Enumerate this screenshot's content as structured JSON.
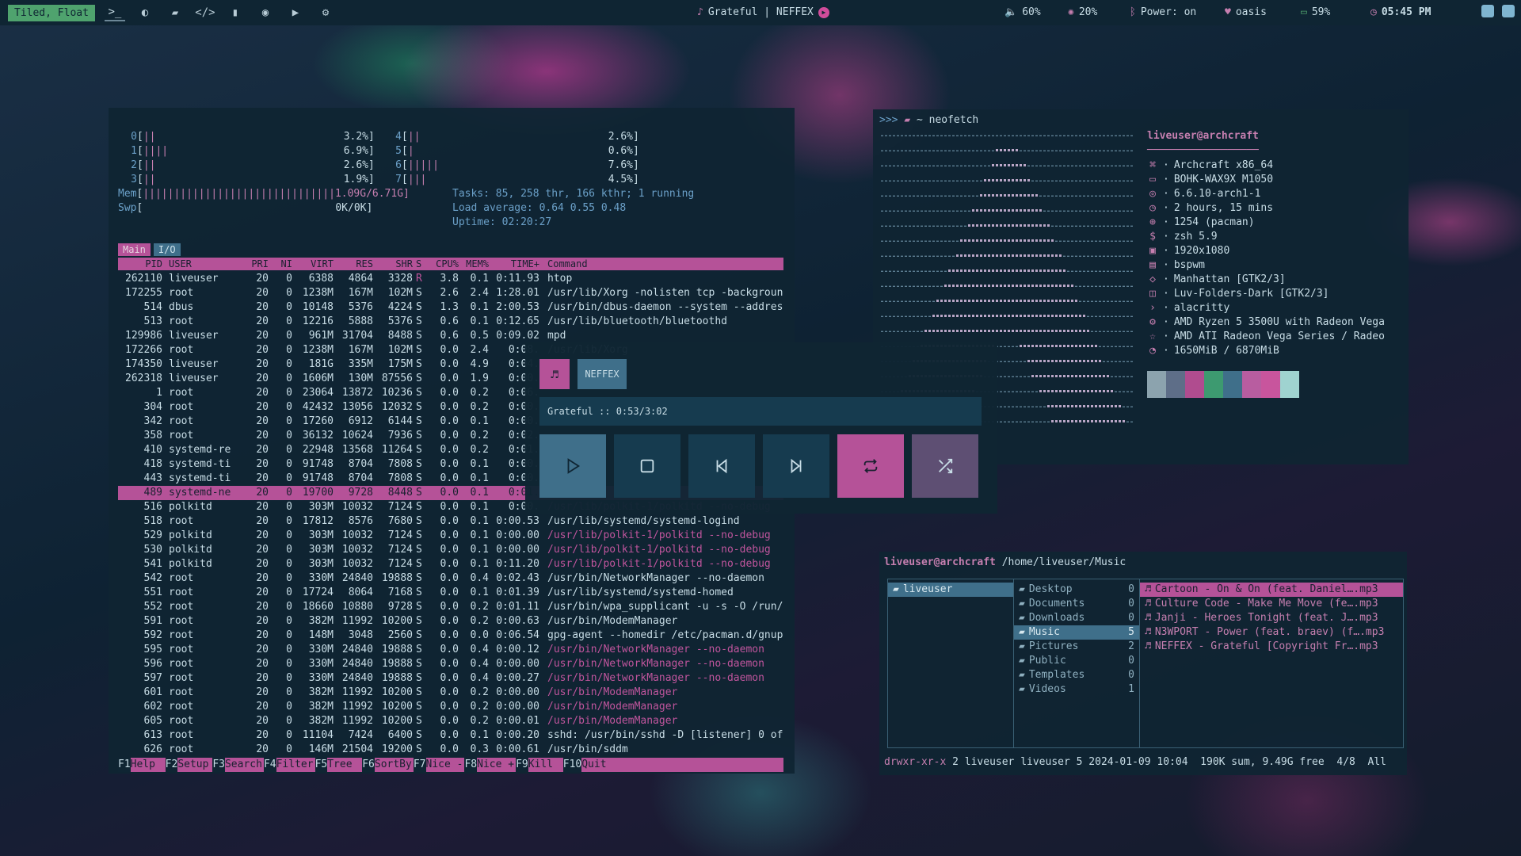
{
  "topbar": {
    "layout": "Tiled, Float",
    "now_playing": "Grateful | NEFFEX",
    "volume": "60%",
    "brightness": "20%",
    "bluetooth": "Power: on",
    "network": "oasis",
    "battery": "59%",
    "clock": "05:45 PM"
  },
  "htop": {
    "cpus": [
      {
        "id": "0",
        "bars": "||",
        "pct": "3.2%]"
      },
      {
        "id": "1",
        "bars": "||||",
        "pct": "6.9%]"
      },
      {
        "id": "2",
        "bars": "||",
        "pct": "2.6%]"
      },
      {
        "id": "3",
        "bars": "||",
        "pct": "1.9%]"
      },
      {
        "id": "4",
        "bars": "||",
        "pct": "2.6%]"
      },
      {
        "id": "5",
        "bars": "|",
        "pct": "0.6%]"
      },
      {
        "id": "6",
        "bars": "|||||",
        "pct": "7.6%]"
      },
      {
        "id": "7",
        "bars": "|||",
        "pct": "4.5%]"
      }
    ],
    "mem_label": "Mem",
    "mem_bars": "|||||||||||||||||||||||||||||||1.09G/6.71G]",
    "swp_label": "Swp",
    "swp_value": "0K/0K]",
    "tasks": "Tasks: 85, 258 thr, 166 kthr; 1 running",
    "load": "Load average: 0.64 0.55 0.48",
    "uptime": "Uptime: 02:20:27",
    "tabs": [
      "Main",
      "I/O"
    ],
    "headers": [
      "PID",
      "USER",
      "PRI",
      "NI",
      "VIRT",
      "RES",
      "SHR",
      "S",
      "CPU%",
      "MEM%",
      "TIME+",
      "Command"
    ],
    "rows": [
      [
        "262110",
        "liveuser",
        "20",
        "0",
        "6388",
        "4864",
        "3328",
        "R",
        "3.8",
        "0.1",
        "0:11.93",
        "htop"
      ],
      [
        "172255",
        "root",
        "20",
        "0",
        "1238M",
        "167M",
        "102M",
        "S",
        "2.6",
        "2.4",
        "1:28.01",
        "/usr/lib/Xorg -nolisten tcp -backgroun"
      ],
      [
        "514",
        "dbus",
        "20",
        "0",
        "10148",
        "5376",
        "4224",
        "S",
        "1.3",
        "0.1",
        "2:00.53",
        "/usr/bin/dbus-daemon --system --addres"
      ],
      [
        "513",
        "root",
        "20",
        "0",
        "12216",
        "5888",
        "5376",
        "S",
        "0.6",
        "0.1",
        "0:12.65",
        "/usr/lib/bluetooth/bluetoothd"
      ],
      [
        "129986",
        "liveuser",
        "20",
        "0",
        "961M",
        "31704",
        "8488",
        "S",
        "0.6",
        "0.5",
        "0:09.02",
        "mpd"
      ],
      [
        "172266",
        "root",
        "20",
        "0",
        "1238M",
        "167M",
        "102M",
        "S",
        "0.0",
        "2.4",
        "0:08.",
        "/usr/lib/Xorg"
      ],
      [
        "174350",
        "liveuser",
        "20",
        "0",
        "181G",
        "335M",
        "175M",
        "S",
        "0.0",
        "4.9",
        "0:04.",
        ""
      ],
      [
        "262318",
        "liveuser",
        "20",
        "0",
        "1606M",
        "130M",
        "87556",
        "S",
        "0.0",
        "1.9",
        "0:00.",
        ""
      ],
      [
        "1",
        "root",
        "20",
        "0",
        "23064",
        "13872",
        "10236",
        "S",
        "0.0",
        "0.2",
        "0:06.",
        ""
      ],
      [
        "304",
        "root",
        "20",
        "0",
        "42432",
        "13056",
        "12032",
        "S",
        "0.0",
        "0.2",
        "0:00.",
        ""
      ],
      [
        "342",
        "root",
        "20",
        "0",
        "17260",
        "6912",
        "6144",
        "S",
        "0.0",
        "0.1",
        "0:00.",
        ""
      ],
      [
        "358",
        "root",
        "20",
        "0",
        "36132",
        "10624",
        "7936",
        "S",
        "0.0",
        "0.2",
        "0:02.",
        ""
      ],
      [
        "410",
        "systemd-re",
        "20",
        "0",
        "22948",
        "13568",
        "11264",
        "S",
        "0.0",
        "0.2",
        "0:01.",
        ""
      ],
      [
        "418",
        "systemd-ti",
        "20",
        "0",
        "91748",
        "8704",
        "7808",
        "S",
        "0.0",
        "0.1",
        "0:00.",
        ""
      ],
      [
        "443",
        "systemd-ti",
        "20",
        "0",
        "91748",
        "8704",
        "7808",
        "S",
        "0.0",
        "0.1",
        "0:00.",
        ""
      ],
      [
        "489",
        "systemd-ne",
        "20",
        "0",
        "19700",
        "9728",
        "8448",
        "S",
        "0.0",
        "0.1",
        "0:01.",
        ""
      ],
      [
        "516",
        "polkitd",
        "20",
        "0",
        "303M",
        "10032",
        "7124",
        "S",
        "0.0",
        "0.1",
        "0:00.",
        "/usr/lib/polkit-1/polkitd --no-debug"
      ],
      [
        "518",
        "root",
        "20",
        "0",
        "17812",
        "8576",
        "7680",
        "S",
        "0.0",
        "0.1",
        "0:00.53",
        "/usr/lib/systemd/systemd-logind"
      ],
      [
        "529",
        "polkitd",
        "20",
        "0",
        "303M",
        "10032",
        "7124",
        "S",
        "0.0",
        "0.1",
        "0:00.00",
        "/usr/lib/polkit-1/polkitd --no-debug"
      ],
      [
        "530",
        "polkitd",
        "20",
        "0",
        "303M",
        "10032",
        "7124",
        "S",
        "0.0",
        "0.1",
        "0:00.00",
        "/usr/lib/polkit-1/polkitd --no-debug"
      ],
      [
        "541",
        "polkitd",
        "20",
        "0",
        "303M",
        "10032",
        "7124",
        "S",
        "0.0",
        "0.1",
        "0:11.20",
        "/usr/lib/polkit-1/polkitd --no-debug"
      ],
      [
        "542",
        "root",
        "20",
        "0",
        "330M",
        "24840",
        "19888",
        "S",
        "0.0",
        "0.4",
        "0:02.43",
        "/usr/bin/NetworkManager --no-daemon"
      ],
      [
        "551",
        "root",
        "20",
        "0",
        "17724",
        "8064",
        "7168",
        "S",
        "0.0",
        "0.1",
        "0:01.39",
        "/usr/lib/systemd/systemd-homed"
      ],
      [
        "552",
        "root",
        "20",
        "0",
        "18660",
        "10880",
        "9728",
        "S",
        "0.0",
        "0.2",
        "0:01.11",
        "/usr/bin/wpa_supplicant -u -s -O /run/"
      ],
      [
        "591",
        "root",
        "20",
        "0",
        "382M",
        "11992",
        "10200",
        "S",
        "0.0",
        "0.2",
        "0:00.63",
        "/usr/bin/ModemManager"
      ],
      [
        "592",
        "root",
        "20",
        "0",
        "148M",
        "3048",
        "2560",
        "S",
        "0.0",
        "0.0",
        "0:06.54",
        "gpg-agent --homedir /etc/pacman.d/gnup"
      ],
      [
        "595",
        "root",
        "20",
        "0",
        "330M",
        "24840",
        "19888",
        "S",
        "0.0",
        "0.4",
        "0:00.12",
        "/usr/bin/NetworkManager --no-daemon"
      ],
      [
        "596",
        "root",
        "20",
        "0",
        "330M",
        "24840",
        "19888",
        "S",
        "0.0",
        "0.4",
        "0:00.00",
        "/usr/bin/NetworkManager --no-daemon"
      ],
      [
        "597",
        "root",
        "20",
        "0",
        "330M",
        "24840",
        "19888",
        "S",
        "0.0",
        "0.4",
        "0:00.27",
        "/usr/bin/NetworkManager --no-daemon"
      ],
      [
        "601",
        "root",
        "20",
        "0",
        "382M",
        "11992",
        "10200",
        "S",
        "0.0",
        "0.2",
        "0:00.00",
        "/usr/bin/ModemManager"
      ],
      [
        "602",
        "root",
        "20",
        "0",
        "382M",
        "11992",
        "10200",
        "S",
        "0.0",
        "0.2",
        "0:00.00",
        "/usr/bin/ModemManager"
      ],
      [
        "605",
        "root",
        "20",
        "0",
        "382M",
        "11992",
        "10200",
        "S",
        "0.0",
        "0.2",
        "0:00.01",
        "/usr/bin/ModemManager"
      ],
      [
        "613",
        "root",
        "20",
        "0",
        "11104",
        "7424",
        "6400",
        "S",
        "0.0",
        "0.1",
        "0:00.20",
        "sshd: /usr/bin/sshd -D [listener] 0 of"
      ],
      [
        "626",
        "root",
        "20",
        "0",
        "146M",
        "21504",
        "19200",
        "S",
        "0.0",
        "0.3",
        "0:00.61",
        "/usr/bin/sddm"
      ]
    ],
    "selected_row": 15,
    "thread_rows": [
      16,
      18,
      19,
      20,
      26,
      27,
      28,
      29,
      30,
      31
    ],
    "fkeys": [
      [
        "F1",
        "Help"
      ],
      [
        "F2",
        "Setup"
      ],
      [
        "F3",
        "Search"
      ],
      [
        "F4",
        "Filter"
      ],
      [
        "F5",
        "Tree"
      ],
      [
        "F6",
        "SortBy"
      ],
      [
        "F7",
        "Nice -"
      ],
      [
        "F8",
        "Nice +"
      ],
      [
        "F9",
        "Kill"
      ],
      [
        "F10",
        "Quit"
      ]
    ]
  },
  "neofetch": {
    "prompt": ">>>",
    "cwd": "~ neofetch",
    "user": "liveuser@archcraft",
    "separator": "──────────────────",
    "info": [
      {
        "icon": "⌘",
        "text": "Archcraft x86_64"
      },
      {
        "icon": "▭",
        "text": "BOHK-WAX9X M1050"
      },
      {
        "icon": "◎",
        "text": "6.6.10-arch1-1"
      },
      {
        "icon": "◷",
        "text": "2 hours, 15 mins"
      },
      {
        "icon": "⊕",
        "text": "1254 (pacman)"
      },
      {
        "icon": "$",
        "text": "zsh 5.9"
      },
      {
        "icon": "▣",
        "text": "1920x1080"
      },
      {
        "icon": "▤",
        "text": "bspwm"
      },
      {
        "icon": "◇",
        "text": "Manhattan [GTK2/3]"
      },
      {
        "icon": "◫",
        "text": "Luv-Folders-Dark [GTK2/3]"
      },
      {
        "icon": "›",
        "text": "alacritty"
      },
      {
        "icon": "⚙",
        "text": "AMD Ryzen 5 3500U with Radeon Vega"
      },
      {
        "icon": "☆",
        "text": "AMD ATI Radeon Vega Series / Radeo"
      },
      {
        "icon": "◔",
        "text": "1650MiB / 6870MiB"
      }
    ],
    "palette": [
      "#8ca3ae",
      "#5e6e88",
      "#b04c8f",
      "#3d9a70",
      "#3f6f8a",
      "#b85da0",
      "#c8559d",
      "#9fd3d0"
    ]
  },
  "player": {
    "artist": "NEFFEX",
    "track": "Grateful :: 0:53/3:02",
    "buttons": [
      "play",
      "stop",
      "previous",
      "next",
      "repeat",
      "shuffle"
    ]
  },
  "filemanager": {
    "title_user": "liveuser@archcraft",
    "title_path": "/home/liveuser/Music",
    "col1": [
      {
        "name": "liveuser"
      }
    ],
    "col2": [
      {
        "name": "Desktop",
        "count": "0"
      },
      {
        "name": "Documents",
        "count": "0"
      },
      {
        "name": "Downloads",
        "count": "0"
      },
      {
        "name": "Music",
        "count": "5"
      },
      {
        "name": "Pictures",
        "count": "2"
      },
      {
        "name": "Public",
        "count": "0"
      },
      {
        "name": "Templates",
        "count": "0"
      },
      {
        "name": "Videos",
        "count": "1"
      }
    ],
    "col3": [
      {
        "name": "Cartoon - On & On (feat. Daniel….mp3"
      },
      {
        "name": "Culture Code - Make Me Move (fe….mp3"
      },
      {
        "name": "Janji - Heroes Tonight (feat. J….mp3"
      },
      {
        "name": "N3WPORT - Power (feat. braev) (f….mp3"
      },
      {
        "name": "NEFFEX - Grateful [Copyright Fr….mp3"
      }
    ],
    "status_perm": "drwxr-xr-x",
    "status_rest": " 2 liveuser liveuser 5 2024-01-09 10:04  190K sum, 9.49G free  4/8  All"
  }
}
